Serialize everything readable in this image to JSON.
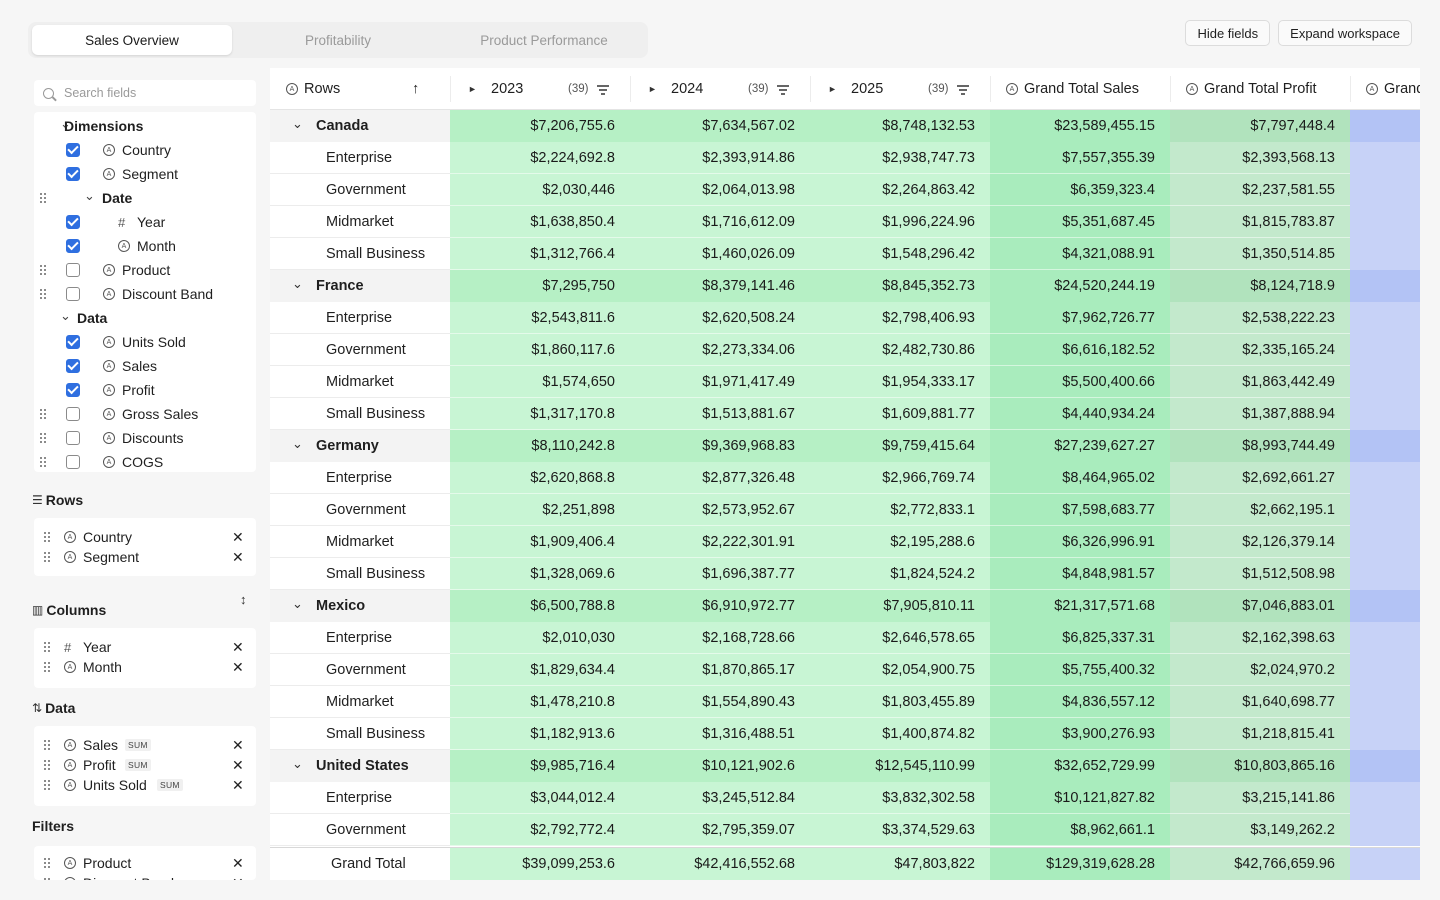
{
  "tabs": [
    "Sales Overview",
    "Profitability",
    "Product Performance"
  ],
  "active_tab": 0,
  "actions": {
    "hide_fields": "Hide fields",
    "expand_workspace": "Expand workspace"
  },
  "search": {
    "placeholder": "Search fields",
    "value": ""
  },
  "tree": {
    "dimensions": "Dimensions",
    "date": "Date",
    "data": "Data",
    "fields": {
      "country": {
        "label": "Country",
        "checked": true
      },
      "segment": {
        "label": "Segment",
        "checked": true
      },
      "year": {
        "label": "Year",
        "checked": true
      },
      "month": {
        "label": "Month",
        "checked": true
      },
      "product": {
        "label": "Product",
        "checked": false
      },
      "discount_band": {
        "label": "Discount Band",
        "checked": false
      },
      "units_sold": {
        "label": "Units Sold",
        "checked": true
      },
      "sales": {
        "label": "Sales",
        "checked": true
      },
      "profit": {
        "label": "Profit",
        "checked": true
      },
      "gross_sales": {
        "label": "Gross Sales",
        "checked": false
      },
      "discounts": {
        "label": "Discounts",
        "checked": false
      },
      "cogs": {
        "label": "COGS",
        "checked": false
      }
    }
  },
  "sections": {
    "rows": {
      "title": "Rows",
      "items": [
        "Country",
        "Segment"
      ]
    },
    "columns": {
      "title": "Columns",
      "items": [
        "Year",
        "Month"
      ]
    },
    "data": {
      "title": "Data",
      "items": [
        "Sales",
        "Profit",
        "Units Sold"
      ],
      "agg": "SUM"
    },
    "filters": {
      "title": "Filters",
      "items": [
        "Product",
        "Discount Band"
      ]
    }
  },
  "table": {
    "rows_header": "Rows",
    "years": [
      {
        "label": "2023",
        "count": "(39)"
      },
      {
        "label": "2024",
        "count": "(39)"
      },
      {
        "label": "2025",
        "count": "(39)"
      }
    ],
    "grand_total_sales": "Grand Total Sales",
    "grand_total_profit": "Grand Total Profit",
    "grand_next": "Grand",
    "grand_total_label": "Grand Total",
    "colors": {
      "sales_green": "#c8f5d4",
      "sales_green_group": "#b6f0c5",
      "total_green": "#a9ecbd",
      "profit_green": "#c3e9cc",
      "profit_green_group": "#b1e3bd",
      "blue": "#c7d2f7",
      "blue_group": "#b3c3f5"
    },
    "groups": [
      {
        "country": "Canada",
        "values": [
          "$7,206,755.6",
          "$7,634,567.02",
          "$8,748,132.53",
          "$23,589,455.15",
          "$7,797,448.4"
        ],
        "segments": [
          {
            "name": "Enterprise",
            "values": [
              "$2,224,692.8",
              "$2,393,914.86",
              "$2,938,747.73",
              "$7,557,355.39",
              "$2,393,568.13"
            ]
          },
          {
            "name": "Government",
            "values": [
              "$2,030,446",
              "$2,064,013.98",
              "$2,264,863.42",
              "$6,359,323.4",
              "$2,237,581.55"
            ]
          },
          {
            "name": "Midmarket",
            "values": [
              "$1,638,850.4",
              "$1,716,612.09",
              "$1,996,224.96",
              "$5,351,687.45",
              "$1,815,783.87"
            ]
          },
          {
            "name": "Small Business",
            "values": [
              "$1,312,766.4",
              "$1,460,026.09",
              "$1,548,296.42",
              "$4,321,088.91",
              "$1,350,514.85"
            ]
          }
        ]
      },
      {
        "country": "France",
        "values": [
          "$7,295,750",
          "$8,379,141.46",
          "$8,845,352.73",
          "$24,520,244.19",
          "$8,124,718.9"
        ],
        "segments": [
          {
            "name": "Enterprise",
            "values": [
              "$2,543,811.6",
              "$2,620,508.24",
              "$2,798,406.93",
              "$7,962,726.77",
              "$2,538,222.23"
            ]
          },
          {
            "name": "Government",
            "values": [
              "$1,860,117.6",
              "$2,273,334.06",
              "$2,482,730.86",
              "$6,616,182.52",
              "$2,335,165.24"
            ]
          },
          {
            "name": "Midmarket",
            "values": [
              "$1,574,650",
              "$1,971,417.49",
              "$1,954,333.17",
              "$5,500,400.66",
              "$1,863,442.49"
            ]
          },
          {
            "name": "Small Business",
            "values": [
              "$1,317,170.8",
              "$1,513,881.67",
              "$1,609,881.77",
              "$4,440,934.24",
              "$1,387,888.94"
            ]
          }
        ]
      },
      {
        "country": "Germany",
        "values": [
          "$8,110,242.8",
          "$9,369,968.83",
          "$9,759,415.64",
          "$27,239,627.27",
          "$8,993,744.49"
        ],
        "segments": [
          {
            "name": "Enterprise",
            "values": [
              "$2,620,868.8",
              "$2,877,326.48",
              "$2,966,769.74",
              "$8,464,965.02",
              "$2,692,661.27"
            ]
          },
          {
            "name": "Government",
            "values": [
              "$2,251,898",
              "$2,573,952.67",
              "$2,772,833.1",
              "$7,598,683.77",
              "$2,662,195.1"
            ]
          },
          {
            "name": "Midmarket",
            "values": [
              "$1,909,406.4",
              "$2,222,301.91",
              "$2,195,288.6",
              "$6,326,996.91",
              "$2,126,379.14"
            ]
          },
          {
            "name": "Small Business",
            "values": [
              "$1,328,069.6",
              "$1,696,387.77",
              "$1,824,524.2",
              "$4,848,981.57",
              "$1,512,508.98"
            ]
          }
        ]
      },
      {
        "country": "Mexico",
        "values": [
          "$6,500,788.8",
          "$6,910,972.77",
          "$7,905,810.11",
          "$21,317,571.68",
          "$7,046,883.01"
        ],
        "segments": [
          {
            "name": "Enterprise",
            "values": [
              "$2,010,030",
              "$2,168,728.66",
              "$2,646,578.65",
              "$6,825,337.31",
              "$2,162,398.63"
            ]
          },
          {
            "name": "Government",
            "values": [
              "$1,829,634.4",
              "$1,870,865.17",
              "$2,054,900.75",
              "$5,755,400.32",
              "$2,024,970.2"
            ]
          },
          {
            "name": "Midmarket",
            "values": [
              "$1,478,210.8",
              "$1,554,890.43",
              "$1,803,455.89",
              "$4,836,557.12",
              "$1,640,698.77"
            ]
          },
          {
            "name": "Small Business",
            "values": [
              "$1,182,913.6",
              "$1,316,488.51",
              "$1,400,874.82",
              "$3,900,276.93",
              "$1,218,815.41"
            ]
          }
        ]
      },
      {
        "country": "United States",
        "values": [
          "$9,985,716.4",
          "$10,121,902.6",
          "$12,545,110.99",
          "$32,652,729.99",
          "$10,803,865.16"
        ],
        "segments": [
          {
            "name": "Enterprise",
            "values": [
              "$3,044,012.4",
              "$3,245,512.84",
              "$3,832,302.58",
              "$10,121,827.82",
              "$3,215,141.86"
            ]
          },
          {
            "name": "Government",
            "values": [
              "$2,792,772.4",
              "$2,795,359.07",
              "$3,374,529.63",
              "$8,962,661.1",
              "$3,149,262.2"
            ]
          }
        ]
      }
    ],
    "grand_total": [
      "$39,099,253.6",
      "$42,416,552.68",
      "$47,803,822",
      "$129,319,628.28",
      "$42,766,659.96"
    ]
  }
}
